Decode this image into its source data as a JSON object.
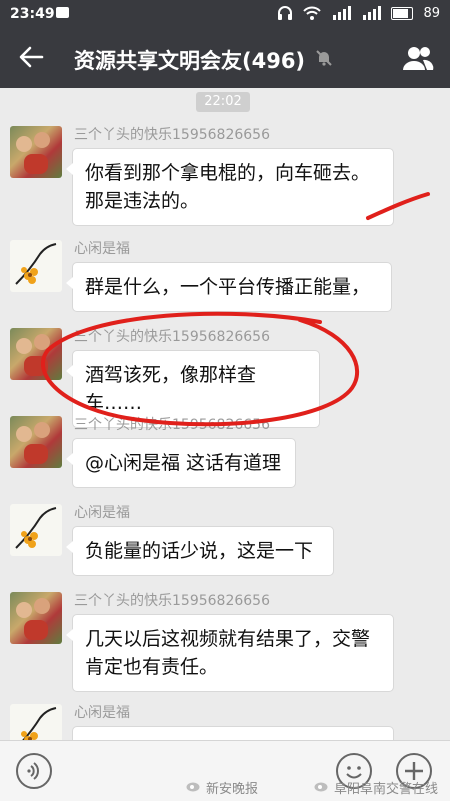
{
  "status_bar": {
    "time": "23:49",
    "battery_level": "89"
  },
  "header": {
    "title": "资源共享文明会友(496)"
  },
  "chat": {
    "timestamp": "22:02",
    "messages": [
      {
        "sender": "三个丫头的快乐15956826656",
        "text": "你看到那个拿电棍的，向车砸去。那是违法的。"
      },
      {
        "sender": "心闲是福",
        "text": "群是什么，一个平台传播正能量，"
      },
      {
        "sender": "三个丫头的快乐15956826656",
        "text": "酒驾该死，像那样查车……"
      },
      {
        "sender": "三个丫头的快乐15956826656",
        "text": "@心闲是福 这话有道理"
      },
      {
        "sender": "心闲是福",
        "text": "负能量的话少说，这是一下"
      },
      {
        "sender": "三个丫头的快乐15956826656",
        "text": "几天以后这视频就有结果了，交警肯定也有责任。"
      },
      {
        "sender": "心闲是福",
        "text": ""
      }
    ]
  },
  "watermarks": {
    "left": "新安晚报",
    "right": "阜阳阜南交警在线"
  },
  "colors": {
    "header_bg": "#393a3f",
    "chat_bg": "#ebebeb",
    "annotation": "#e0201b"
  }
}
